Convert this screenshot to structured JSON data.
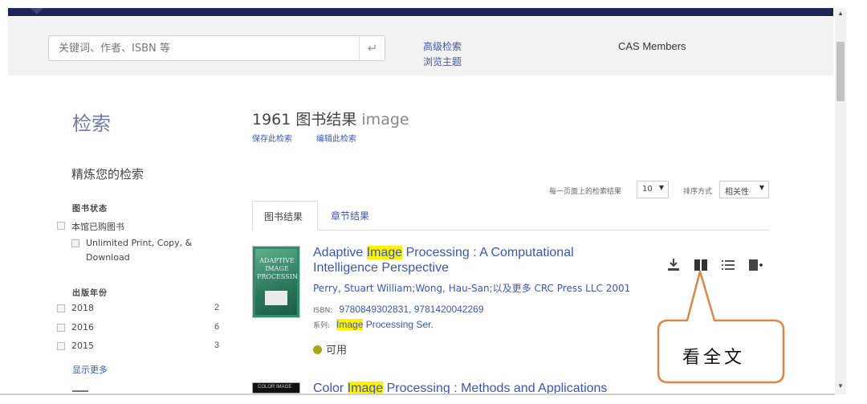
{
  "header": {
    "search_placeholder": "关键词、作者、ISBN 等",
    "submit_icon": "↵",
    "advanced_search": "高级检索",
    "browse_subjects": "浏览主题",
    "members": "CAS Members"
  },
  "sidebar": {
    "title": "检索",
    "refine_title": "精炼您的检索",
    "book_status": {
      "heading": "图书状态",
      "items": [
        {
          "label": "本馆已购图书"
        },
        {
          "label": "Unlimited Print, Copy, &",
          "label2": "Download"
        }
      ]
    },
    "pub_year": {
      "heading": "出版年份",
      "items": [
        {
          "label": "2018",
          "count": "2"
        },
        {
          "label": "2016",
          "count": "6"
        },
        {
          "label": "2015",
          "count": "3"
        }
      ]
    },
    "show_more": "显示更多"
  },
  "results": {
    "count_label": "1961 图书结果",
    "query": "image",
    "save_search": "保存此检索",
    "edit_search": "编辑此检索",
    "per_page_label": "每一页面上的检索结果",
    "per_page_value": "10",
    "sort_label": "排序方式",
    "sort_value": "相关性",
    "tabs": [
      {
        "label": "图书结果"
      },
      {
        "label": "章节结果"
      }
    ]
  },
  "book1": {
    "cover_text": "ADAPTIVE IMAGE PROCESSING",
    "title_pre": "Adaptive ",
    "title_hl": "Image",
    "title_post": " Processing : A Computational Intelligence Perspective",
    "authors": "Perry, Stuart William;Wong, Hau-San;以及更多  CRC Press LLC  2001",
    "isbn_label": "ISBN:",
    "isbn": "9780849302831, 9781420042269",
    "series_label": "系列:",
    "series_hl": "Image",
    "series_post": " Processing Ser.",
    "availability": "可用"
  },
  "book2": {
    "cover_text": "COLOR IMAGE",
    "title_pre": "Color ",
    "title_hl": "Image",
    "title_post": " Processing : Methods and Applications"
  },
  "callout": {
    "text": "看全文",
    "color": "#d9884a"
  }
}
